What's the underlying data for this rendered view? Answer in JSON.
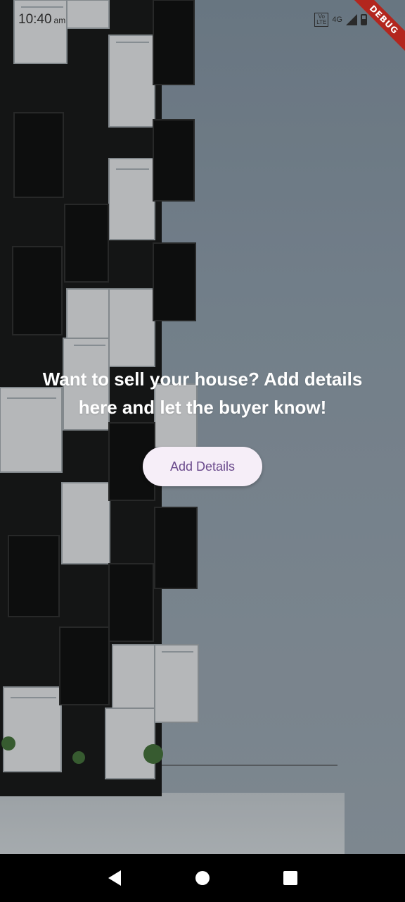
{
  "status_bar": {
    "time": "10:40",
    "ampm": "am",
    "volte_line1": "Vo",
    "volte_line2": "LTE",
    "network": "4G",
    "icons": [
      "volte-icon",
      "signal-icon",
      "battery-icon"
    ]
  },
  "debug_banner": {
    "label": "DEBUG",
    "color": "#b3261e"
  },
  "hero": {
    "title": "Want to sell your house? Add details here and let the buyer know!",
    "button_label": "Add Details"
  },
  "nav_bar": {
    "icons": [
      "back-icon",
      "home-icon",
      "recents-icon"
    ]
  },
  "colors": {
    "button_bg": "#f6eef8",
    "button_text": "#6a4a8c",
    "title_text": "#ffffff"
  }
}
